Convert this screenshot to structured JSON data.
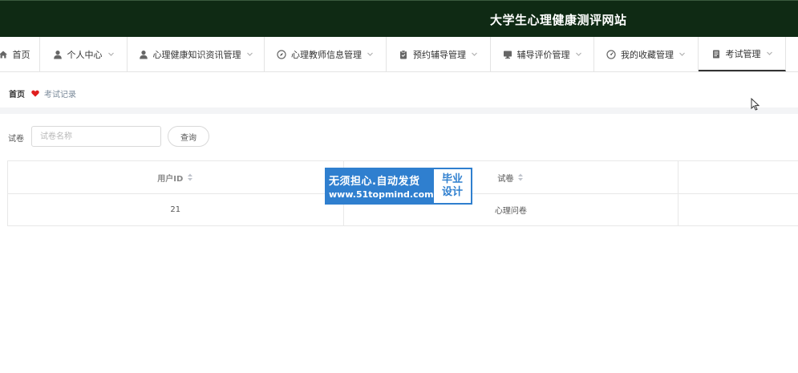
{
  "header": {
    "title": "大学生心理健康测评网站"
  },
  "nav": {
    "items": [
      {
        "label": "首页",
        "icon": "home-icon",
        "dropdown": false
      },
      {
        "label": "个人中心",
        "icon": "user-icon",
        "dropdown": true
      },
      {
        "label": "心理健康知识资讯管理",
        "icon": "user-icon",
        "dropdown": true
      },
      {
        "label": "心理教师信息管理",
        "icon": "compass-icon",
        "dropdown": true
      },
      {
        "label": "预约辅导管理",
        "icon": "clipboard-icon",
        "dropdown": true
      },
      {
        "label": "辅导评价管理",
        "icon": "monitor-icon",
        "dropdown": true
      },
      {
        "label": "我的收藏管理",
        "icon": "gauge-icon",
        "dropdown": true
      },
      {
        "label": "考试管理",
        "icon": "document-icon",
        "dropdown": true,
        "active": true
      }
    ]
  },
  "breadcrumb": {
    "home": "首页",
    "current": "考试记录"
  },
  "search": {
    "label": "试卷",
    "placeholder": "试卷名称",
    "value": "",
    "button_label": "查询"
  },
  "table": {
    "columns": [
      "用户ID",
      "试卷",
      ""
    ],
    "rows": [
      [
        "21",
        "心理问卷",
        ""
      ]
    ]
  },
  "watermark": {
    "line1": "无须担心.自动发货",
    "line2": "www.51topmind.com",
    "badge_top": "毕业",
    "badge_bottom": "设计"
  },
  "colors": {
    "header_bg": "#0f2a14",
    "accent": "#2f7fcf",
    "heart": "#e02020"
  }
}
